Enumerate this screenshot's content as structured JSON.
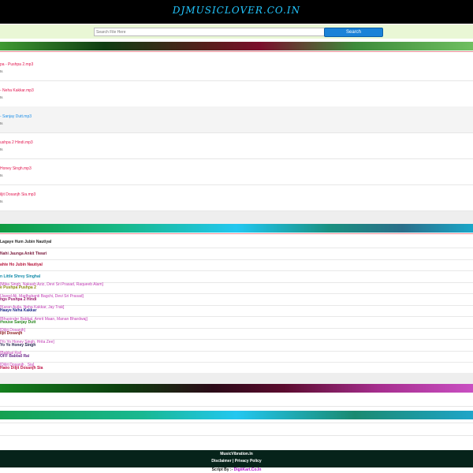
{
  "header": {
    "logo": "DJMUSICLOVER.CO.IN"
  },
  "search": {
    "placeholder": "Search File Here",
    "button": "Search"
  },
  "files": [
    {
      "name": "pa - Pushpa 2.mp3",
      "meta": "ts"
    },
    {
      "name": "- Neha Kakkar.mp3",
      "meta": "ts"
    },
    {
      "name": "- Sanjay Dutt.mp3",
      "meta": "ts"
    },
    {
      "name": "ushpa 2 Hindi.mp3",
      "meta": "ts"
    },
    {
      "name": "Honey Singh.mp3",
      "meta": "ts"
    },
    {
      "name": "iljit Dosanjh Sia.mp3",
      "meta": "ts"
    }
  ],
  "songs": [
    {
      "title": "Lagaye Hum Jubin Nautiyal",
      "artists": "",
      "color": "#2b2b2b"
    },
    {
      "title": "Nahi Jaunga Ankit Tiwari",
      "artists": "",
      "color": "#7a1b3d"
    },
    {
      "title": "ahte Ho Jubin Nautiyal",
      "artists": "",
      "color": "#b8163c"
    },
    {
      "title": "n Little Shrey Singhal",
      "artists": "",
      "color": "#0f8aa8"
    },
    {
      "title": "e Pushpa Pushpa 2",
      "artists": "[Mika Singh, Nakash Aziz, Devi Sri Prasad, Raqueeb Alam]",
      "color": "#8a8a12"
    },
    {
      "title": "ngs Pushpa 2 Hindi",
      "artists": "[Javed Ali, Madhubanti Bagchi, Devi Sri Prasad]",
      "color": "#9b1a6e"
    },
    {
      "title": "Haaye Neha Kakkar",
      "artists": "[Karan Aujla, Neha Kakkar, Jay Trak]",
      "color": "#1e2a8a"
    },
    {
      "title": "rhouse Sanjay Dutt",
      "artists": "[Bhupinder Babbal, Amrit Maan, Manan Bhardwaj]",
      "color": "#2c8a22"
    },
    {
      "title": "iljit Dosanjh",
      "artists": "[Diljit Dosanjh]",
      "color": "#8a1a1a"
    },
    {
      "title": "Yo Yo Honey Singh",
      "artists": "[Yo Yo Honey Singh, Hrita Zee]",
      "color": "#1e1e4a"
    },
    {
      "title": "OFF Babbal Rai",
      "artists": "[Babbal Rai]",
      "color": "#6a2a8a"
    },
    {
      "title": "Haeo Diljit Dosanjh Sia",
      "artists": "[Diljit Dosanjh , Sia]",
      "color": "#c0174a"
    }
  ],
  "footer": {
    "site": "MusicVibration.In",
    "disclaimer": "Disclaimer",
    "separator": "|",
    "privacy": "Privacy Policy",
    "script_prefix": "Script By :-",
    "script_brand": "DigiiKart.Co.In"
  }
}
